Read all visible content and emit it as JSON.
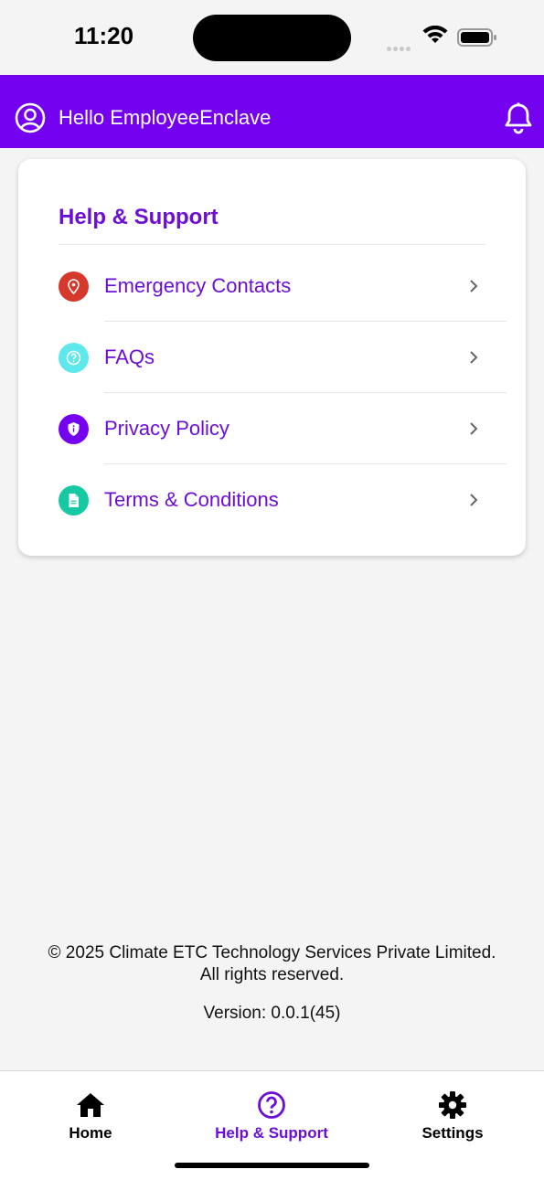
{
  "status_bar": {
    "time": "11:20"
  },
  "header": {
    "greeting": "Hello EmployeeEnclave",
    "background_color": "#7402f0"
  },
  "card": {
    "title": "Help & Support",
    "items": [
      {
        "label": "Emergency Contacts",
        "icon": "location-pin-icon",
        "icon_color": "#d6392c"
      },
      {
        "label": "FAQs",
        "icon": "question-circle-icon",
        "icon_color": "#5ee8ec"
      },
      {
        "label": "Privacy Policy",
        "icon": "shield-info-icon",
        "icon_color": "#7402f0"
      },
      {
        "label": "Terms & Conditions",
        "icon": "document-icon",
        "icon_color": "#17c9a3"
      }
    ]
  },
  "footer": {
    "copyright_line1": "© 2025 Climate ETC Technology Services Private Limited.",
    "copyright_line2": "All rights reserved.",
    "version": "Version: 0.0.1(45)"
  },
  "tabbar": {
    "tabs": [
      {
        "label": "Home",
        "icon": "home-icon",
        "active": false
      },
      {
        "label": "Help & Support",
        "icon": "help-circle-icon",
        "active": true
      },
      {
        "label": "Settings",
        "icon": "gear-icon",
        "active": false
      }
    ],
    "active_color": "#6b0fd6"
  }
}
